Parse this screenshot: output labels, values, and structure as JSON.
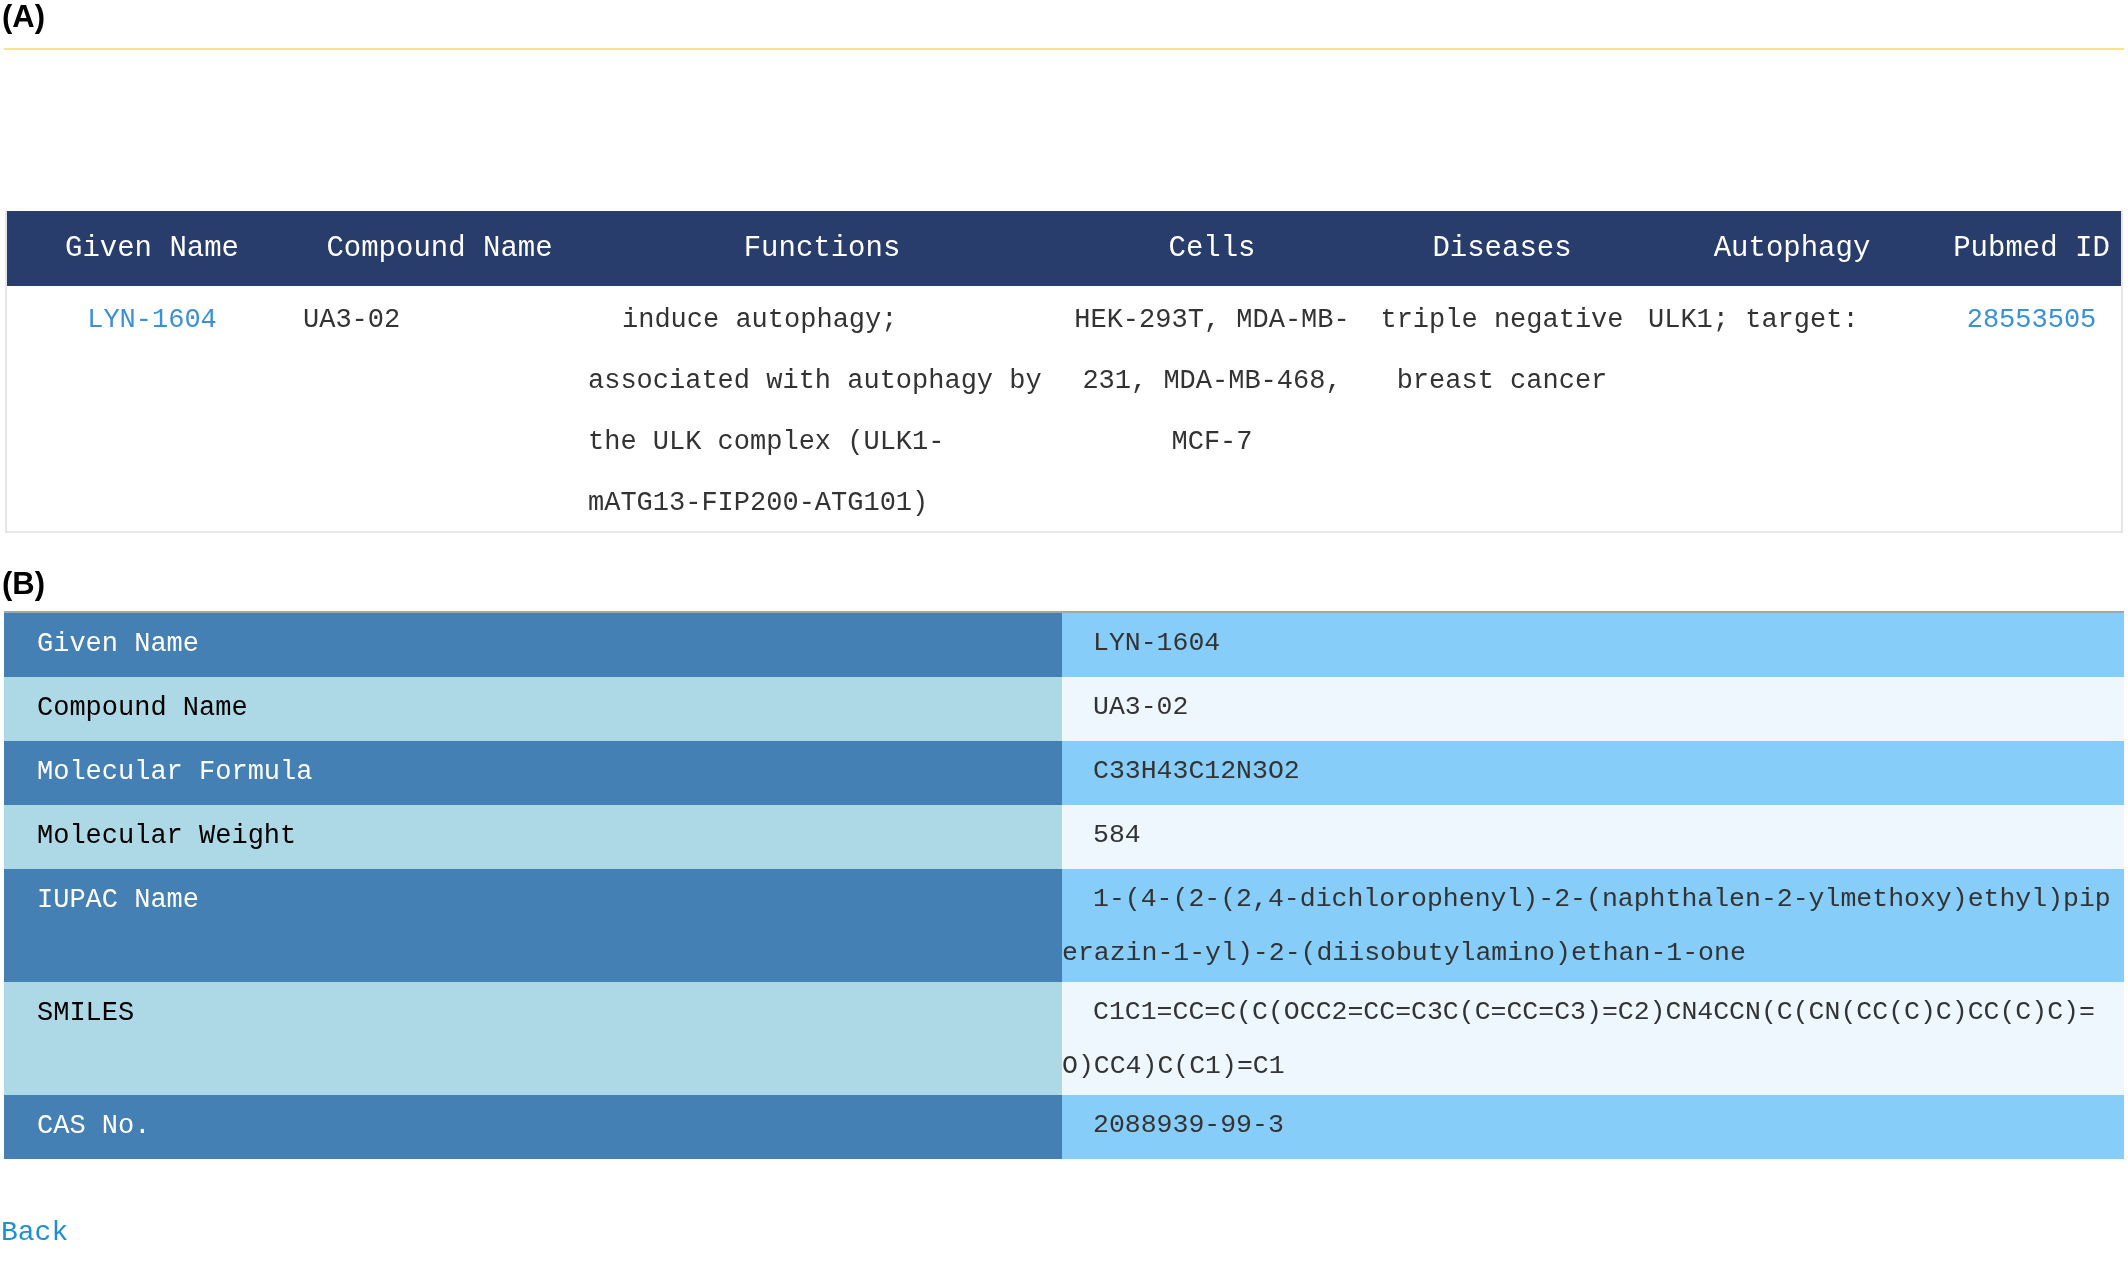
{
  "panel_a": {
    "label": "(A)",
    "table": {
      "columns": [
        "Given Name",
        "Compound Name",
        "Functions",
        "Cells",
        "Diseases",
        "Autophagy",
        "Pubmed ID"
      ],
      "rows": [
        {
          "given_name": "LYN-1604",
          "compound_name": "UA3-02",
          "functions": "induce autophagy; associated with autophagy by the ULK complex (ULK1-mATG13-FIP200-ATG101)",
          "cells": "HEK-293T, MDA-MB-231, MDA-MB-468, MCF-7",
          "diseases": "triple negative breast cancer",
          "autophagy": "ULK1; target:",
          "pubmed_id": "28553505"
        }
      ]
    }
  },
  "panel_b": {
    "label": "(B)",
    "rows": [
      {
        "label": "Given Name",
        "value": "LYN-1604"
      },
      {
        "label": "Compound Name",
        "value": "UA3-02"
      },
      {
        "label": "Molecular Formula",
        "value": "C33H43C12N3O2"
      },
      {
        "label": "Molecular Weight",
        "value": "584"
      },
      {
        "label": "IUPAC Name",
        "value": "1-(4-(2-(2,4-dichlorophenyl)-2-(naphthalen-2-ylmethoxy)ethyl)piperazin-1-yl)-2-(diisobutylamino)ethan-1-one"
      },
      {
        "label": "SMILES",
        "value": "C1C1=CC=C(C(OCC2=CC=C3C(C=CC=C3)=C2)CN4CCN(C(CN(CC(C)C)CC(C)C)=O)CC4)C(C1)=C1"
      },
      {
        "label": "CAS No.",
        "value": "2088939-99-3"
      }
    ],
    "back_link": "Back"
  }
}
